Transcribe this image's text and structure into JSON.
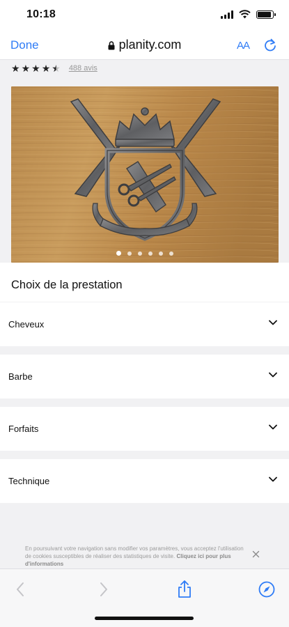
{
  "status_bar": {
    "time": "10:18",
    "battery_level": 0.9
  },
  "browser": {
    "done_label": "Done",
    "url": "planity.com",
    "text_size_label": "AA"
  },
  "rating": {
    "stars": 4.5,
    "reviews_label": "488 avis"
  },
  "carousel": {
    "image": "barber-crest-photo",
    "total_slides": 6,
    "active_slide": 1
  },
  "section": {
    "title": "Choix de la prestation"
  },
  "categories": [
    {
      "label": "Cheveux"
    },
    {
      "label": "Barbe"
    },
    {
      "label": "Forfaits"
    },
    {
      "label": "Technique"
    }
  ],
  "cookie": {
    "text": "En poursuivant votre navigation sans modifier vos paramètres, vous acceptez l'utilisation de cookies susceptibles de réaliser des statistiques de visite.",
    "link": "Cliquez ici pour plus d'informations"
  },
  "colors": {
    "accent": "#2f7cf6",
    "page_bg": "#f1f1f3"
  }
}
